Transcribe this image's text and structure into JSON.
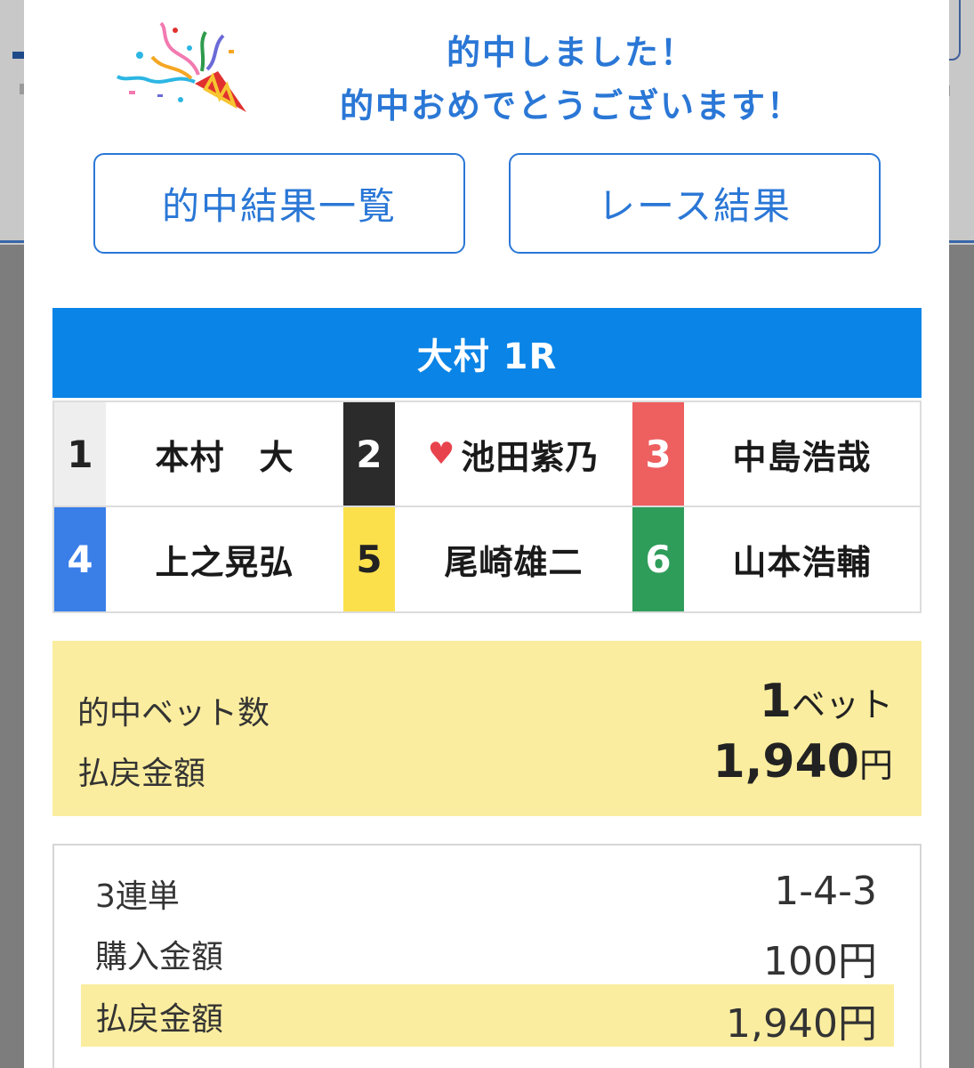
{
  "header": {
    "line1": "的中しました！",
    "line2": "的中おめでとうございます！"
  },
  "buttons": {
    "hit_results": "的中結果一覧",
    "race_results": "レース結果"
  },
  "race": {
    "title": "大村 1R",
    "racers": [
      {
        "number": "1",
        "name": "本村　大",
        "color": "#eeeeee",
        "text_color": "#222222",
        "favorite": false
      },
      {
        "number": "2",
        "name": "池田紫乃",
        "color": "#2b2b2b",
        "text_color": "#ffffff",
        "favorite": true
      },
      {
        "number": "3",
        "name": "中島浩哉",
        "color": "#ee5f5f",
        "text_color": "#ffffff",
        "favorite": false
      },
      {
        "number": "4",
        "name": "上之晃弘",
        "color": "#3a7ee8",
        "text_color": "#ffffff",
        "favorite": false
      },
      {
        "number": "5",
        "name": "尾崎雄二",
        "color": "#fbe04c",
        "text_color": "#222222",
        "favorite": false
      },
      {
        "number": "6",
        "name": "山本浩輔",
        "color": "#2f9d5a",
        "text_color": "#ffffff",
        "favorite": false
      }
    ]
  },
  "summary": {
    "bet_count_label": "的中ベット数",
    "bet_count_number": "1",
    "bet_count_unit": "ベット",
    "payout_label": "払戻金額",
    "payout_number": "1,940",
    "payout_unit": "円"
  },
  "detail": {
    "bet_type": "3連単",
    "combination": "1-4-3",
    "purchase_label": "購入金額",
    "purchase_value": "100円",
    "payout_label": "払戻金額",
    "payout_value": "1,940円"
  },
  "colors": {
    "accent": "#2a77d6",
    "header_bar": "#0a84e6",
    "highlight": "#fbed9f"
  }
}
